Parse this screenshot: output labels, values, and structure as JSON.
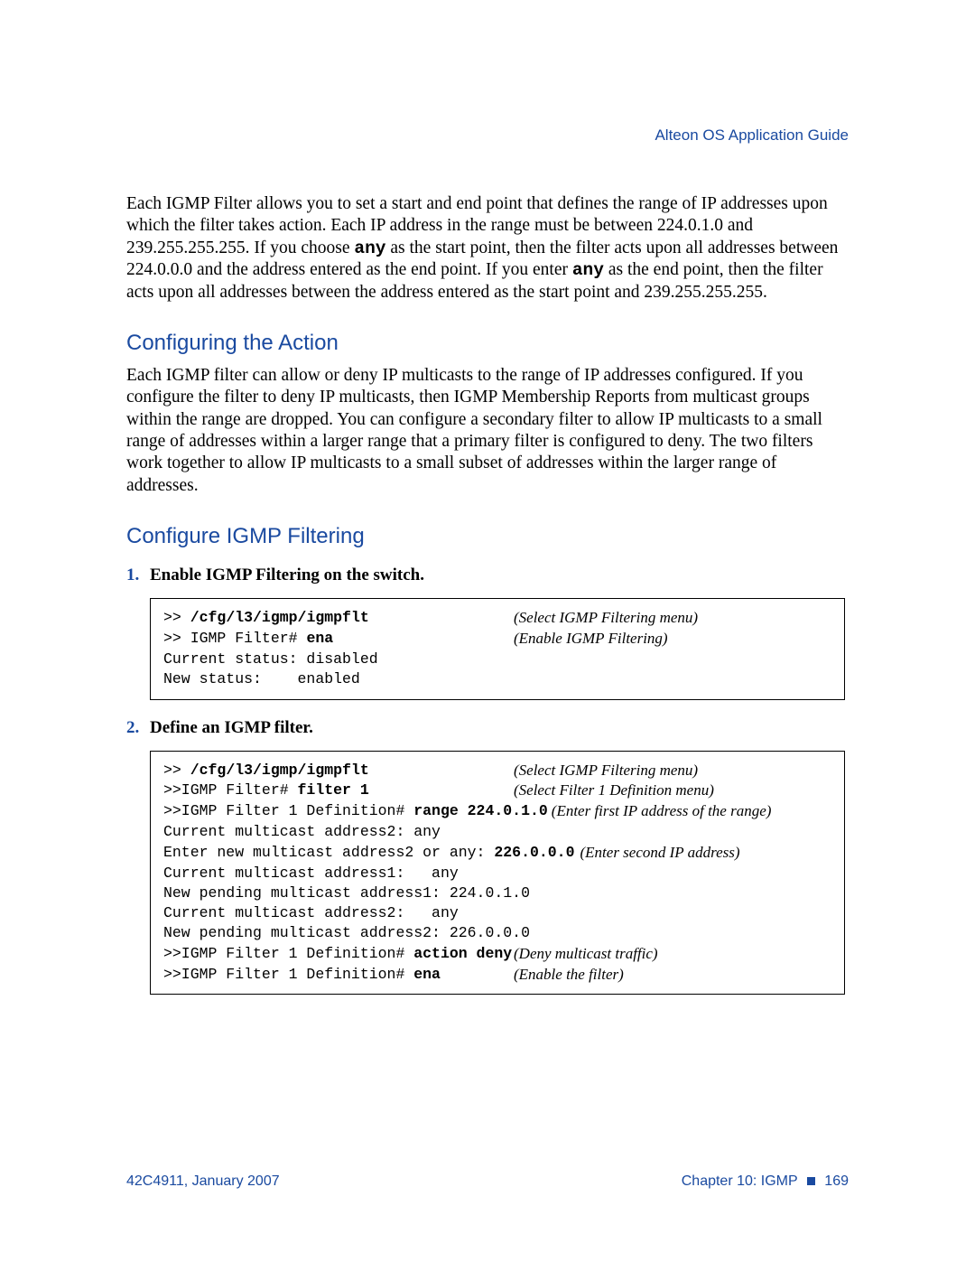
{
  "header": {
    "running": "Alteon OS  Application Guide"
  },
  "paras": {
    "intro": "Each IGMP Filter allows you to set a start and end point that defines the range of IP addresses upon which the filter takes action. Each IP address in the range must be between 224.0.1.0 and 239.255.255.255. If you choose ",
    "intro_b1": "any",
    "intro_mid": " as the start point, then the filter acts upon all addresses between 224.0.0.0 and the address entered as the end point. If you enter ",
    "intro_b2": "any",
    "intro_end": " as the end point, then the filter acts upon all addresses between the address entered as the start point and 239.255.255.255."
  },
  "section1": {
    "title": "Configuring the Action",
    "body": "Each IGMP filter can allow or deny IP multicasts to the range of IP addresses configured. If you configure the filter to deny IP multicasts, then IGMP Membership Reports from multicast groups within the range are dropped. You can configure a secondary filter to allow IP multicasts to a small range of addresses within a larger range that a primary filter is configured to deny. The two filters work together to allow IP multicasts to a small subset of addresses within the larger range of addresses."
  },
  "section2": {
    "title": "Configure IGMP Filtering",
    "steps": [
      {
        "num": "1.",
        "text": "Enable IGMP Filtering on the switch."
      },
      {
        "num": "2.",
        "text": "Define an IGMP filter."
      }
    ]
  },
  "code1": {
    "r1_pre": ">> ",
    "r1_cmd": "/cfg/l3/igmp/igmpflt",
    "r1_note": "(Select IGMP Filtering menu)",
    "r2_pre": ">> IGMP Filter# ",
    "r2_cmd": "ena",
    "r2_note": "(Enable IGMP Filtering)",
    "r3": "Current status: disabled",
    "r4": "New status:    enabled"
  },
  "code2": {
    "r1_pre": ">> ",
    "r1_cmd": "/cfg/l3/igmp/igmpflt",
    "r1_note": "(Select IGMP Filtering menu)",
    "r2_pre": ">>IGMP Filter# ",
    "r2_cmd": "filter 1",
    "r2_note": "(Select Filter 1 Definition menu)",
    "r3_pre": ">>IGMP Filter 1 Definition# ",
    "r3_cmd": "range 224.0.1.0",
    "r3_note": "(Enter first IP address of the range)",
    "r4": "Current multicast address2: any",
    "r5_pre": "Enter new multicast address2 or any: ",
    "r5_cmd": "226.0.0.0",
    "r5_note": "(Enter second IP address)",
    "r6": "Current multicast address1:   any",
    "r7": "New pending multicast address1: 224.0.1.0",
    "r8": "Current multicast address2:   any",
    "r9": "New pending multicast address2: 226.0.0.0",
    "r10_pre": ">>IGMP Filter 1 Definition# ",
    "r10_cmd": "action deny",
    "r10_note": "(Deny multicast traffic)",
    "r11_pre": ">>IGMP Filter 1 Definition# ",
    "r11_cmd": "ena",
    "r11_note": "(Enable the filter)"
  },
  "footer": {
    "left": "42C4911, January 2007",
    "right_chapter": "Chapter 10:  IGMP",
    "right_page": "169"
  }
}
